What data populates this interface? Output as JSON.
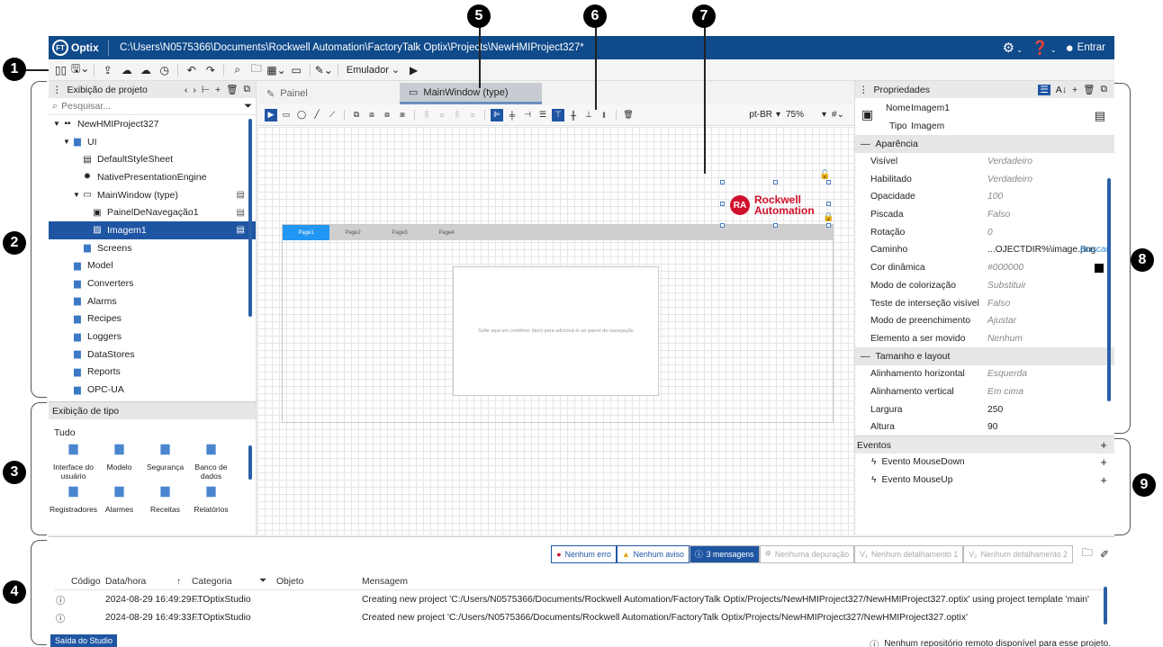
{
  "titlebar": {
    "logo": "Optix",
    "logo_badge": "FT",
    "path": "C:\\Users\\N0575366\\Documents\\Rockwell Automation\\FactoryTalk Optix\\Projects\\NewHMIProject327*",
    "login": "Entrar"
  },
  "toolbar": {
    "emulator_label": "Emulador"
  },
  "project_panel": {
    "title": "Exibição de projeto",
    "search_placeholder": "Pesquisar...",
    "tree": [
      {
        "label": "NewHMIProject327",
        "level": 0,
        "icon": "project-icon"
      },
      {
        "label": "UI",
        "level": 1,
        "icon": "folder-icon"
      },
      {
        "label": "DefaultStyleSheet",
        "level": 2,
        "icon": "stylesheet-icon"
      },
      {
        "label": "NativePresentationEngine",
        "level": 2,
        "icon": "gear-icon"
      },
      {
        "label": "MainWindow (type)",
        "level": 2,
        "icon": "window-icon"
      },
      {
        "label": "PainelDeNavegação1",
        "level": 3,
        "icon": "navpanel-icon"
      },
      {
        "label": "Imagem1",
        "level": 3,
        "icon": "image-icon",
        "selected": true
      },
      {
        "label": "Screens",
        "level": 2,
        "icon": "folder-icon"
      },
      {
        "label": "Model",
        "level": 1,
        "icon": "folder-icon"
      },
      {
        "label": "Converters",
        "level": 1,
        "icon": "folder-icon"
      },
      {
        "label": "Alarms",
        "level": 1,
        "icon": "folder-icon"
      },
      {
        "label": "Recipes",
        "level": 1,
        "icon": "folder-icon"
      },
      {
        "label": "Loggers",
        "level": 1,
        "icon": "folder-icon"
      },
      {
        "label": "DataStores",
        "level": 1,
        "icon": "folder-icon"
      },
      {
        "label": "Reports",
        "level": 1,
        "icon": "folder-icon"
      },
      {
        "label": "OPC-UA",
        "level": 1,
        "icon": "folder-icon"
      }
    ]
  },
  "type_panel": {
    "title": "Exibição de tipo",
    "filter": "Tudo",
    "items": [
      "Interface do usuário",
      "Modelo",
      "Segurança",
      "Banco de dados",
      "Registradores",
      "Alarmes",
      "Receitas",
      "Relatórios"
    ]
  },
  "editor": {
    "tabs": [
      {
        "label": "Painel",
        "active": false
      },
      {
        "label": "MainWindow (type)",
        "active": true
      }
    ],
    "locale": "pt-BR",
    "zoom": "75%",
    "nav_tabs": [
      "Page1",
      "Page2",
      "Page3",
      "Page4"
    ],
    "dropzone_text": "Solte aqui um contêiner (tipo) para adicioná-lo ao painel de navegação",
    "logo_line1": "Rockwell",
    "logo_line2": "Automation",
    "logo_badge": "RA"
  },
  "properties": {
    "title": "Propriedades",
    "name_label": "Nome",
    "name_value": "Imagem1",
    "type_label": "Tipo",
    "type_value": "Imagem",
    "sections": [
      {
        "title": "Aparência",
        "rows": [
          {
            "key": "Visível",
            "value": "Verdadeiro"
          },
          {
            "key": "Habilitado",
            "value": "Verdadeiro"
          },
          {
            "key": "Opacidade",
            "value": "100"
          },
          {
            "key": "Piscada",
            "value": "Falso"
          },
          {
            "key": "Rotação",
            "value": "0"
          },
          {
            "key": "Caminho",
            "value": "...OJECTDIR%\\image.png",
            "action": "Buscar"
          },
          {
            "key": "Cor dinâmica",
            "value": "#000000"
          },
          {
            "key": "Modo de colorização",
            "value": "Substituir"
          },
          {
            "key": "Teste de interseção visível",
            "value": "Falso"
          },
          {
            "key": "Modo de preenchimento",
            "value": "Ajustar"
          },
          {
            "key": "Elemento a ser movido",
            "value": "Nenhum"
          }
        ]
      },
      {
        "title": "Tamanho e layout",
        "rows": [
          {
            "key": "Alinhamento horizontal",
            "value": "Esquerda"
          },
          {
            "key": "Alinhamento vertical",
            "value": "Em cima"
          },
          {
            "key": "Largura",
            "value": "250"
          },
          {
            "key": "Altura",
            "value": "90"
          }
        ]
      }
    ]
  },
  "events": {
    "title": "Eventos",
    "items": [
      "Evento MouseDown",
      "Evento MouseUp"
    ]
  },
  "output": {
    "filters": [
      {
        "label": "Nenhum erro",
        "state": "normal"
      },
      {
        "label": "Nenhum aviso",
        "state": "normal"
      },
      {
        "label": "3 mensagens",
        "state": "active"
      },
      {
        "label": "Nenhuma depuração",
        "state": "disabled"
      },
      {
        "label": "Nenhum detalhamento 1",
        "state": "disabled"
      },
      {
        "label": "Nenhum detalhamento 2",
        "state": "disabled"
      }
    ],
    "columns": [
      "Código",
      "Data/hora",
      "Categoria",
      "Objeto",
      "Mensagem"
    ],
    "rows": [
      {
        "date": "2024-08-29 16:49:29...",
        "category": "FTOptixStudio",
        "message": "Creating new project 'C:/Users/N0575366/Documents/Rockwell Automation/FactoryTalk Optix/Projects/NewHMIProject327/NewHMIProject327.optix' using project template 'main'"
      },
      {
        "date": "2024-08-29 16:49:33...",
        "category": "FTOptixStudio",
        "message": "Created new project 'C:/Users/N0575366/Documents/Rockwell Automation/FactoryTalk Optix/Projects/NewHMIProject327/NewHMIProject327.optix'"
      }
    ],
    "tab": "Saída do Studio",
    "status": "Nenhum repositório remoto disponível para esse projeto."
  },
  "callouts": [
    "1",
    "2",
    "3",
    "4",
    "5",
    "6",
    "7",
    "8",
    "9"
  ],
  "colors": {
    "titlebar": "#0f4a8a",
    "accent": "#1f56a3",
    "nav_tab_active": "#2196f3",
    "rockwell_red": "#d0102b"
  }
}
